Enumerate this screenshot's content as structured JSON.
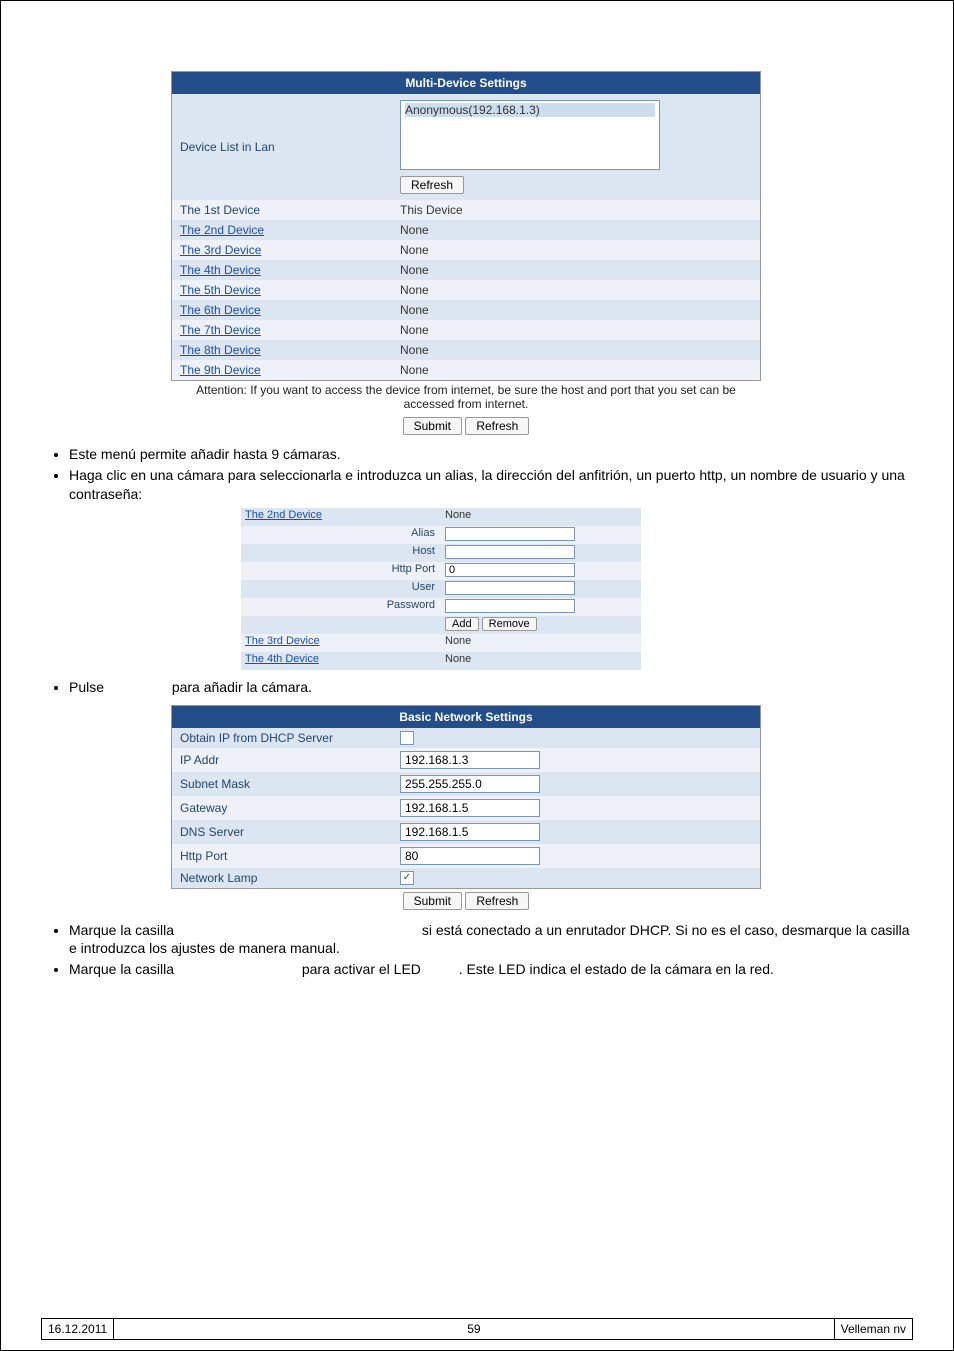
{
  "multiDevice": {
    "header": "Multi-Device Settings",
    "deviceListLabel": "Device List in Lan",
    "deviceListItem": "Anonymous(192.168.1.3)",
    "refresh": "Refresh",
    "rows": [
      {
        "label": "The 1st Device",
        "value": "This Device",
        "link": false
      },
      {
        "label": "The 2nd Device",
        "value": "None",
        "link": true
      },
      {
        "label": "The 3rd Device",
        "value": "None",
        "link": true
      },
      {
        "label": "The 4th Device",
        "value": "None",
        "link": true
      },
      {
        "label": "The 5th Device",
        "value": "None",
        "link": true
      },
      {
        "label": "The 6th Device",
        "value": "None",
        "link": true
      },
      {
        "label": "The 7th Device",
        "value": "None",
        "link": true
      },
      {
        "label": "The 8th Device",
        "value": "None",
        "link": true
      },
      {
        "label": "The 9th Device",
        "value": "None",
        "link": true
      }
    ],
    "attention": "Attention: If you want to access the device from internet, be sure the host and port that you set can be accessed from internet.",
    "submit": "Submit"
  },
  "text1": "Este menú permite añadir hasta 9 cámaras.",
  "text2": "Haga clic en una cámara para seleccionarla e introduzca un alias, la dirección del anfitrión, un puerto http, un nombre de usuario y una contraseña:",
  "addForm": {
    "device2": "The 2nd Device",
    "device2val": "None",
    "alias": "Alias",
    "host": "Host",
    "httpPort": "Http Port",
    "httpPortVal": "0",
    "user": "User",
    "password": "Password",
    "add": "Add",
    "remove": "Remove",
    "device3": "The 3rd Device",
    "device3val": "None",
    "device4": "The 4th Device",
    "device4val": "None"
  },
  "text3a": "Pulse",
  "text3b": "para añadir la cámara.",
  "network": {
    "header": "Basic Network Settings",
    "dhcp": "Obtain IP from DHCP Server",
    "ipaddr": "IP Addr",
    "ipaddrVal": "192.168.1.3",
    "subnet": "Subnet Mask",
    "subnetVal": "255.255.255.0",
    "gateway": "Gateway",
    "gatewayVal": "192.168.1.5",
    "dns": "DNS Server",
    "dnsVal": "192.168.1.5",
    "httpPort": "Http Port",
    "httpPortVal": "80",
    "lamp": "Network Lamp",
    "submit": "Submit",
    "refresh": "Refresh"
  },
  "text4": "Marque la casilla",
  "text4b": "si está conectado a un enrutador DHCP. Si no es el caso, desmarque la casilla e introduzca los ajustes de manera manual.",
  "text5a": "Marque la casilla",
  "text5b": "para activar el LED",
  "text5c": ". Este LED indica el estado de la cámara en la red.",
  "footer": {
    "date": "16.12.2011",
    "page": "59",
    "right": "Velleman nv"
  }
}
